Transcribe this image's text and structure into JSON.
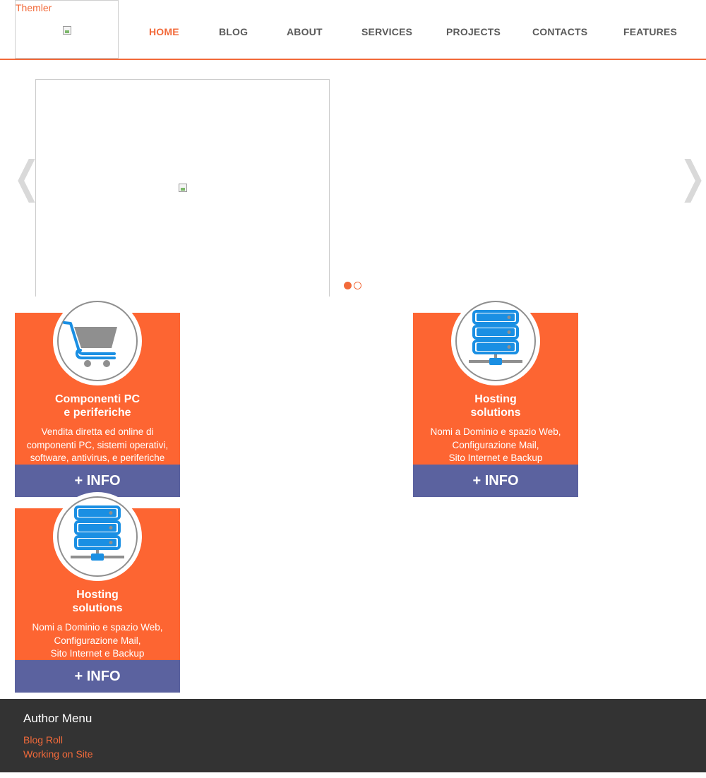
{
  "header": {
    "logo_text": "Themler",
    "nav": [
      {
        "label": "HOME",
        "active": true
      },
      {
        "label": "BLOG",
        "active": false
      },
      {
        "label": "ABOUT",
        "active": false
      },
      {
        "label": "SERVICES",
        "active": false
      },
      {
        "label": "PROJECTS",
        "active": false
      },
      {
        "label": "CONTACTS",
        "active": false
      },
      {
        "label": "FEATURES",
        "active": false
      }
    ]
  },
  "slider": {
    "prev_glyph": "❬",
    "next_glyph": "❭",
    "slide_count": 2,
    "active_slide": 1
  },
  "cards": [
    {
      "icon": "shopping-cart-icon",
      "title_line1": "Componenti PC",
      "title_line2": "e periferiche",
      "desc_line1": "Vendita diretta ed online di",
      "desc_line2": "componenti PC, sistemi operativi,",
      "desc_line3": "software, antivirus, e periferiche",
      "button": "+ INFO"
    },
    {
      "icon": "server-icon",
      "title_line1": "Hosting",
      "title_line2": "solutions",
      "desc_line1": "Nomi a Dominio e spazio Web,",
      "desc_line2": "Configurazione Mail,",
      "desc_line3": "Sito Internet e Backup",
      "button": "+ INFO"
    },
    {
      "icon": "server-icon",
      "title_line1": "Hosting",
      "title_line2": "solutions",
      "desc_line1": "Nomi a Dominio e spazio Web,",
      "desc_line2": "Configurazione Mail,",
      "desc_line3": "Sito Internet e Backup",
      "button": "+ INFO"
    }
  ],
  "footer": {
    "title": "Author Menu",
    "links": [
      "Blog Roll",
      "Working on Site"
    ]
  },
  "colors": {
    "accent": "#f26a3a",
    "card_bg": "#fd6532",
    "button_bg": "#5b629f",
    "footer_bg": "#333333",
    "server_blue": "#1a8fe3"
  }
}
